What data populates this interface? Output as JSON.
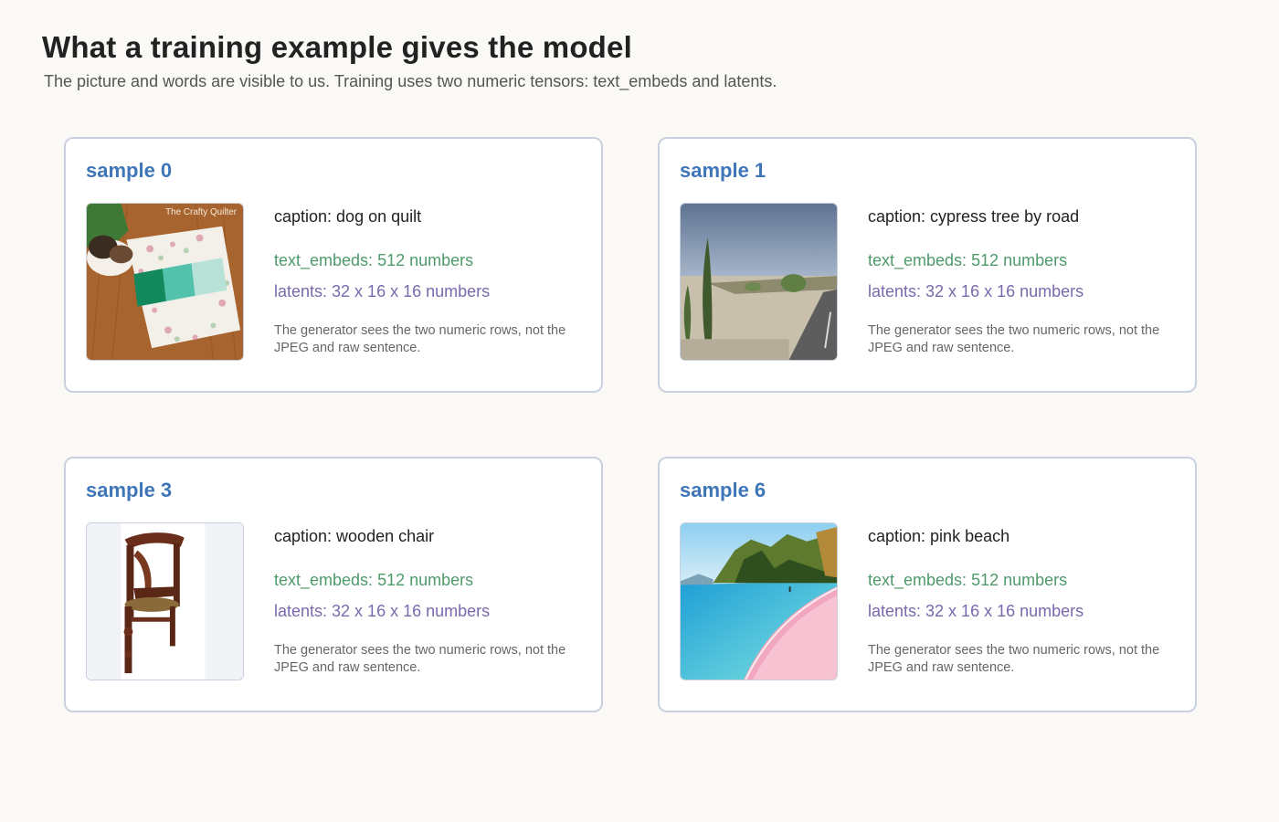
{
  "header": {
    "title": "What a training example gives the model",
    "subtitle": "The picture and words are visible to us. Training uses two numeric tensors: text_embeds and latents."
  },
  "cards": [
    {
      "title": "sample 0",
      "image_icon": "dog-on-quilt-photo",
      "image_watermark": "The Crafty Quilter",
      "caption": "caption: dog on quilt",
      "text_embeds": "text_embeds: 512 numbers",
      "latents": "latents: 32 x 16 x 16 numbers",
      "note": "The generator sees the two numeric rows, not the JPEG and raw sentence."
    },
    {
      "title": "sample 1",
      "image_icon": "cypress-tree-road-photo",
      "caption": "caption: cypress tree by road",
      "text_embeds": "text_embeds: 512 numbers",
      "latents": "latents: 32 x 16 x 16 numbers",
      "note": "The generator sees the two numeric rows, not the JPEG and raw sentence."
    },
    {
      "title": "sample 3",
      "image_icon": "wooden-chair-photo",
      "caption": "caption: wooden chair",
      "text_embeds": "text_embeds: 512 numbers",
      "latents": "latents: 32 x 16 x 16 numbers",
      "note": "The generator sees the two numeric rows, not the JPEG and raw sentence."
    },
    {
      "title": "sample 6",
      "image_icon": "pink-beach-photo",
      "caption": "caption: pink beach",
      "text_embeds": "text_embeds: 512 numbers",
      "latents": "latents: 32 x 16 x 16 numbers",
      "note": "The generator sees the two numeric rows, not the JPEG and raw sentence."
    }
  ]
}
